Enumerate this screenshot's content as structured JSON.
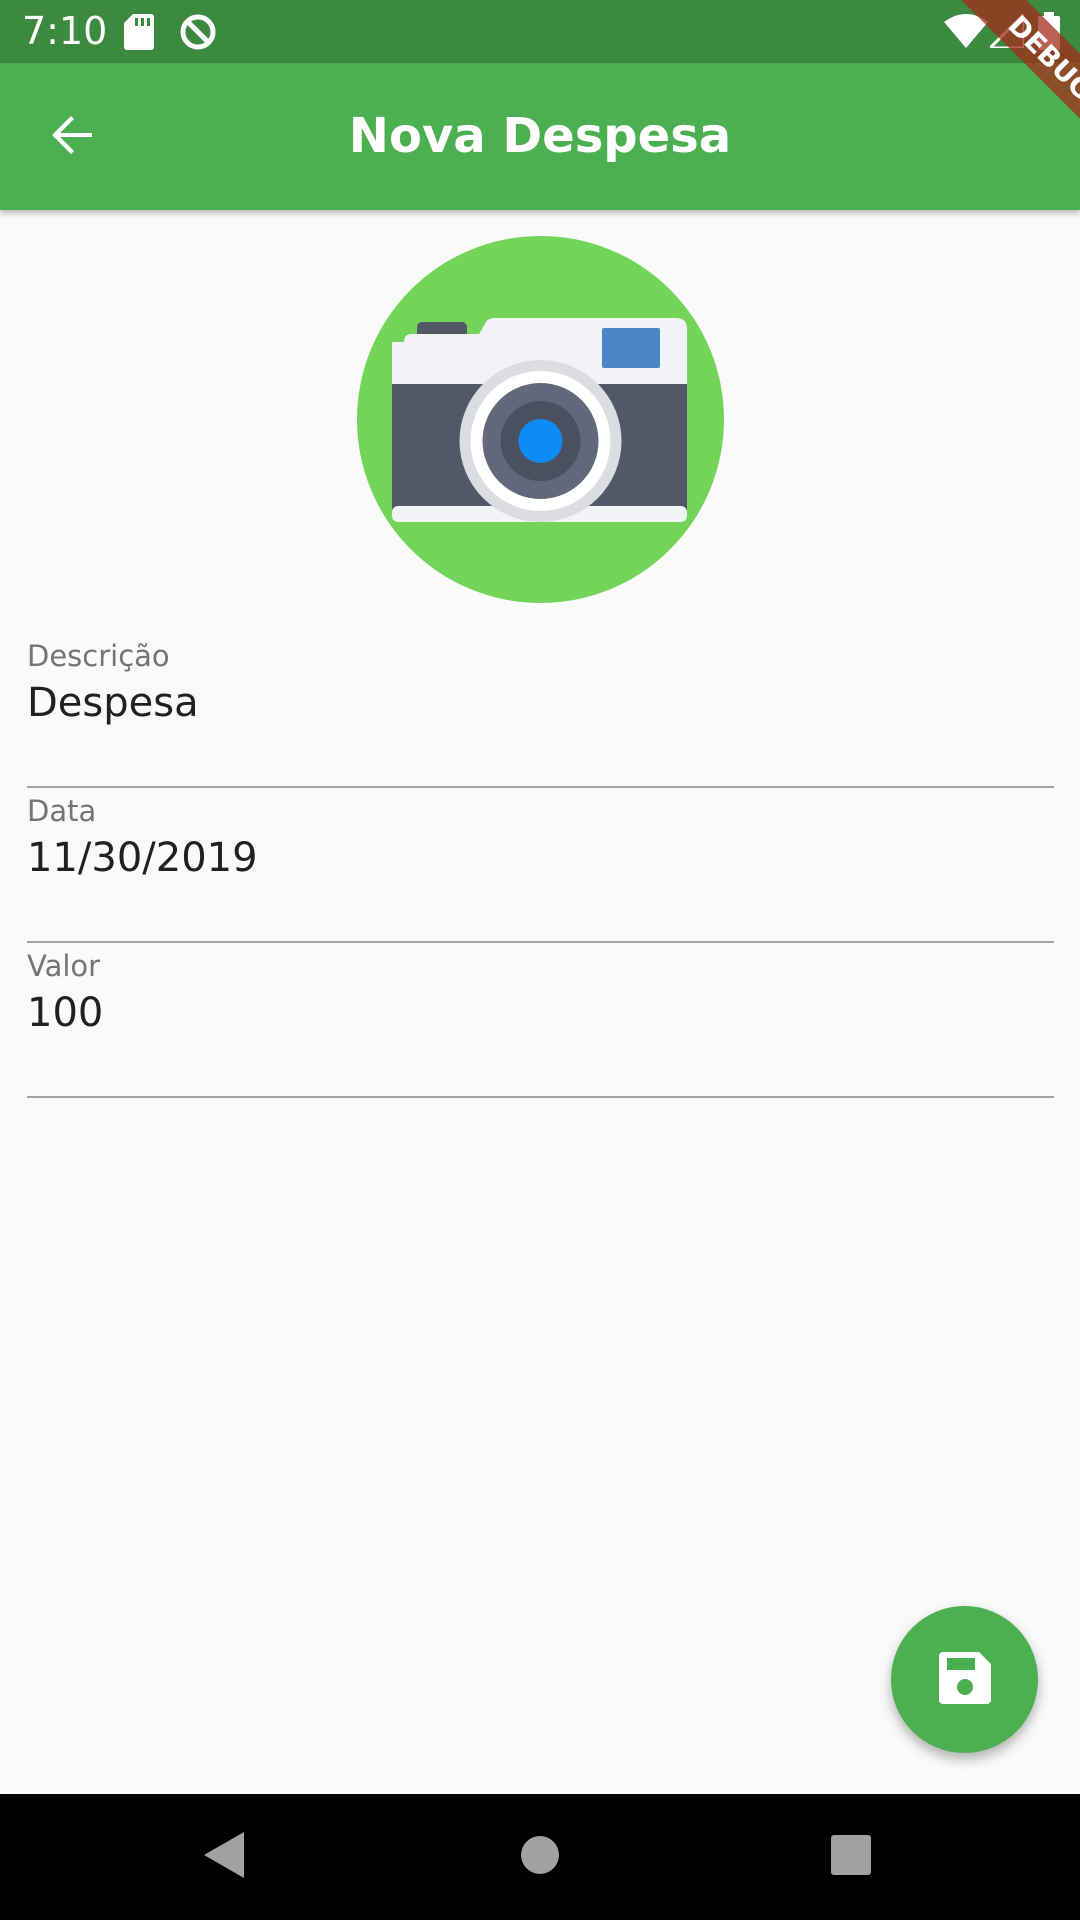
{
  "status_bar": {
    "time": "7:10",
    "icons": [
      "sd-card-icon",
      "sync-icon",
      "wifi-icon",
      "cell-signal-icon",
      "battery-icon"
    ]
  },
  "debug_banner": {
    "label": "DEBUG"
  },
  "app_bar": {
    "title": "Nova Despesa",
    "back_icon": "arrow-back-icon"
  },
  "photo": {
    "icon": "camera-icon"
  },
  "form": {
    "fields": [
      {
        "label": "Descrição",
        "value": "Despesa"
      },
      {
        "label": "Data",
        "value": "11/30/2019"
      },
      {
        "label": "Valor",
        "value": "100"
      }
    ]
  },
  "fab": {
    "icon": "save-icon"
  },
  "nav_bar": {
    "icons": [
      "nav-back-icon",
      "nav-home-icon",
      "nav-recents-icon"
    ]
  },
  "colors": {
    "status_bar": "#3c8a3f",
    "primary": "#4caf50",
    "camera_circle": "#72d55a",
    "background": "#fafafa"
  }
}
